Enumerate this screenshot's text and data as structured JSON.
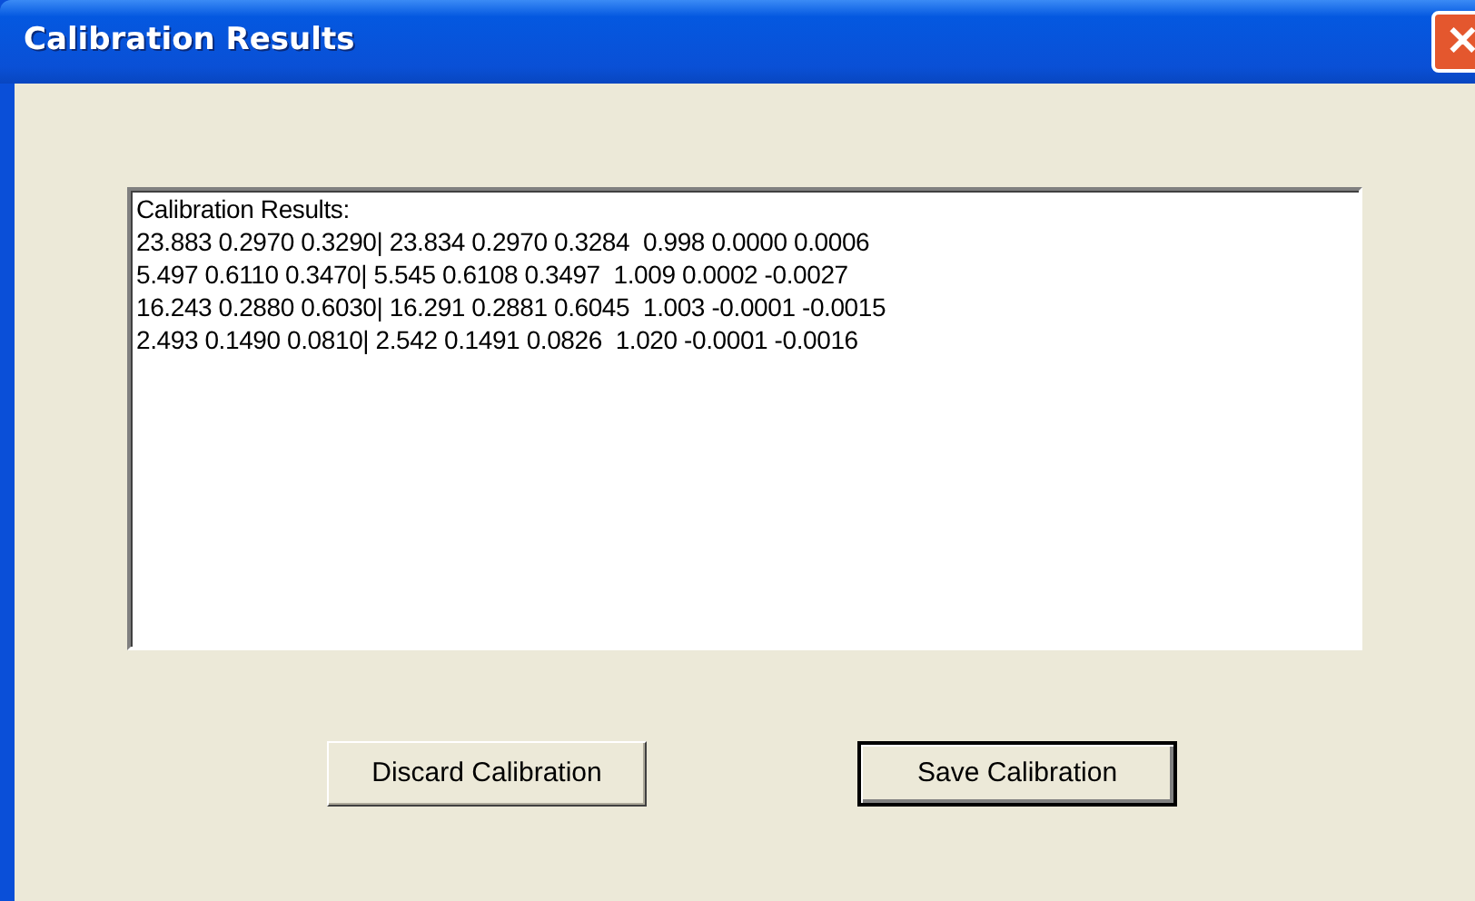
{
  "window": {
    "title": "Calibration Results",
    "close_glyph": "✕"
  },
  "results_box": {
    "lines": [
      "Calibration Results:",
      "23.883 0.2970 0.3290| 23.834 0.2970 0.3284  0.998 0.0000 0.0006",
      "5.497 0.6110 0.3470| 5.545 0.6108 0.3497  1.009 0.0002 -0.0027",
      "16.243 0.2880 0.6030| 16.291 0.2881 0.6045  1.003 -0.0001 -0.0015",
      "2.493 0.1490 0.0810| 2.542 0.1491 0.0826  1.020 -0.0001 -0.0016"
    ]
  },
  "buttons": [
    {
      "label": "Discard Calibration",
      "default": false
    },
    {
      "label": "Save Calibration",
      "default": true
    }
  ]
}
